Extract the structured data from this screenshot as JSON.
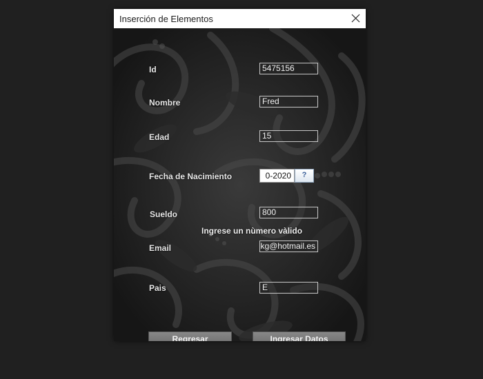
{
  "window": {
    "title": "Inserción de Elementos",
    "close_icon": "close-icon"
  },
  "form": {
    "id_label": "Id",
    "id_value": "5475156",
    "nombre_label": "Nombre",
    "nombre_value": "Fred",
    "edad_label": "Edad",
    "edad_value": "15",
    "fecha_label": "Fecha de Nacimiento",
    "fecha_value": "0-2020",
    "fecha_button_icon": "calendar-picker-icon",
    "fecha_button_glyph": "?",
    "sueldo_label": "Sueldo",
    "sueldo_value": "800",
    "sueldo_error": "Ingrese un nùmero vàlido",
    "email_label": "Email",
    "email_value": "kg@hotmail.es",
    "pais_label": "Pais",
    "pais_value": "E"
  },
  "buttons": {
    "regresar": "Regresar",
    "ingresar": "Ingresar Datos"
  },
  "colors": {
    "background": "#202020",
    "titlebar": "#ffffff",
    "field_border": "#c8c8c8",
    "button": "#7a7a7a",
    "text": "#e8e8e8"
  }
}
